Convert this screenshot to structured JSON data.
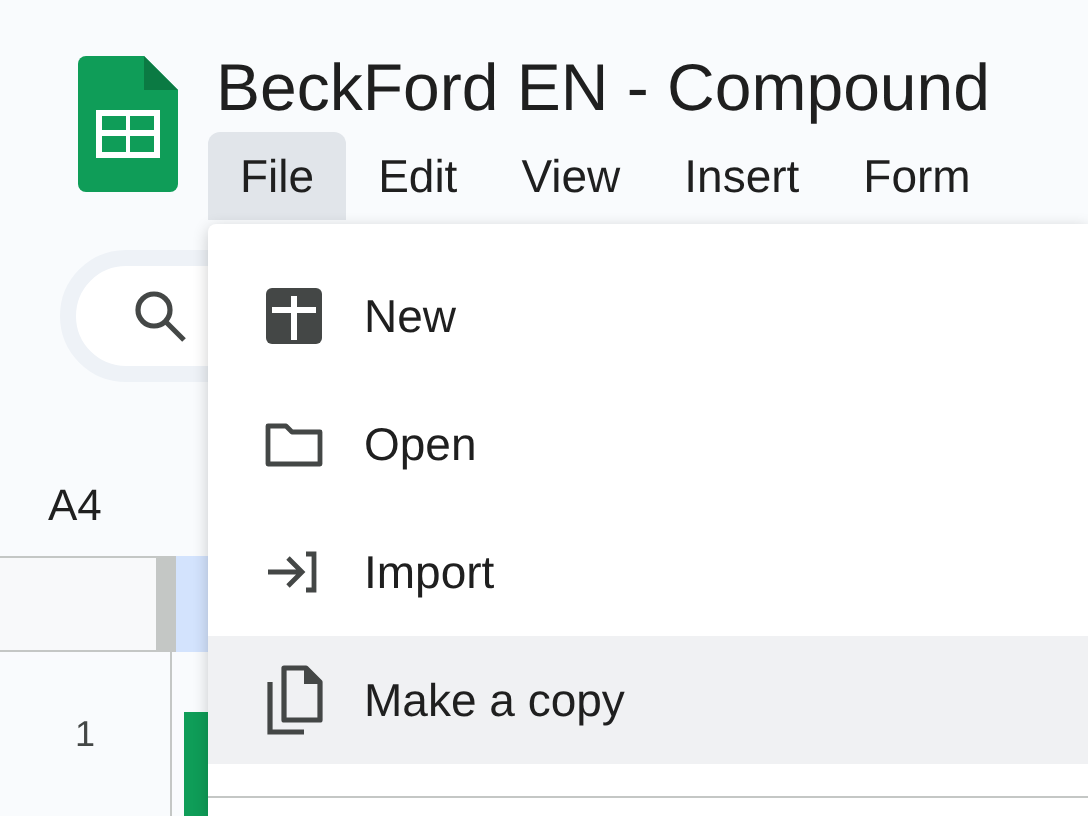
{
  "document": {
    "title": "BeckFord EN - Compound"
  },
  "menubar": [
    {
      "label": "File",
      "selected": true
    },
    {
      "label": "Edit",
      "selected": false
    },
    {
      "label": "View",
      "selected": false
    },
    {
      "label": "Insert",
      "selected": false
    },
    {
      "label": "Form",
      "selected": false
    }
  ],
  "name_box": {
    "value": "A4"
  },
  "row_headers": [
    "1"
  ],
  "file_menu": [
    {
      "kind": "new",
      "label": "New",
      "selected": false
    },
    {
      "kind": "open",
      "label": "Open",
      "selected": false
    },
    {
      "kind": "import",
      "label": "Import",
      "selected": false
    },
    {
      "kind": "copy",
      "label": "Make a copy",
      "selected": true
    }
  ]
}
